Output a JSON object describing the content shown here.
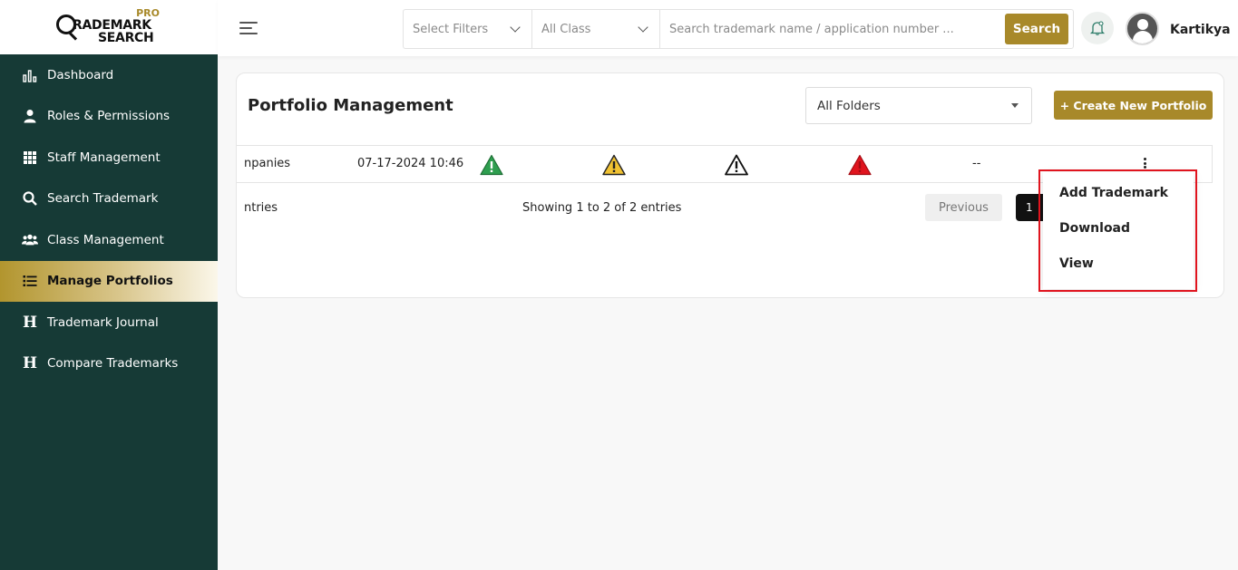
{
  "brand": {
    "pro": "PRO",
    "line1": "RADEMARK",
    "line2": "SEARCH"
  },
  "sidebar": {
    "items": [
      {
        "label": "Dashboard",
        "icon": "bar-chart-icon"
      },
      {
        "label": "Roles & Permissions",
        "icon": "user-icon"
      },
      {
        "label": "Staff Management",
        "icon": "grid-icon"
      },
      {
        "label": "Search Trademark",
        "icon": "search-icon"
      },
      {
        "label": "Class Management",
        "icon": "users-icon"
      },
      {
        "label": "Manage Portfolios",
        "icon": "list-icon",
        "active": true
      },
      {
        "label": "Trademark Journal",
        "icon": "heading-icon"
      },
      {
        "label": "Compare Trademarks",
        "icon": "heading-icon"
      }
    ]
  },
  "topbar": {
    "filter_select": "Select Filters",
    "class_select": "All Class",
    "search_placeholder": "Search trademark name / application number ...",
    "search_button": "Search",
    "username": "Kartikya"
  },
  "portfolio": {
    "title": "Portfolio Management",
    "folder_select": "All Folders",
    "create_button": "+ Create New Portfolio",
    "row": {
      "name": "npanies",
      "date": "07-17-2024 10:46",
      "risk_icons": [
        {
          "name": "green-warning-icon",
          "color": "#2e9e4f"
        },
        {
          "name": "yellow-warning-icon",
          "color": "#f1c232"
        },
        {
          "name": "white-warning-icon",
          "color": "#ffffff"
        },
        {
          "name": "red-warning-icon",
          "color": "#e0141e"
        }
      ],
      "dash": "--"
    },
    "entries_left": "ntries",
    "entries_info": "Showing 1 to 2 of 2 entries",
    "prev_button": "Previous",
    "page_number": "1"
  },
  "menu": {
    "items": [
      "Add Trademark",
      "Download",
      "View"
    ]
  },
  "colors": {
    "sidebar_bg": "#163a36",
    "accent": "#a8892a",
    "highlight_border": "#e0141e"
  }
}
